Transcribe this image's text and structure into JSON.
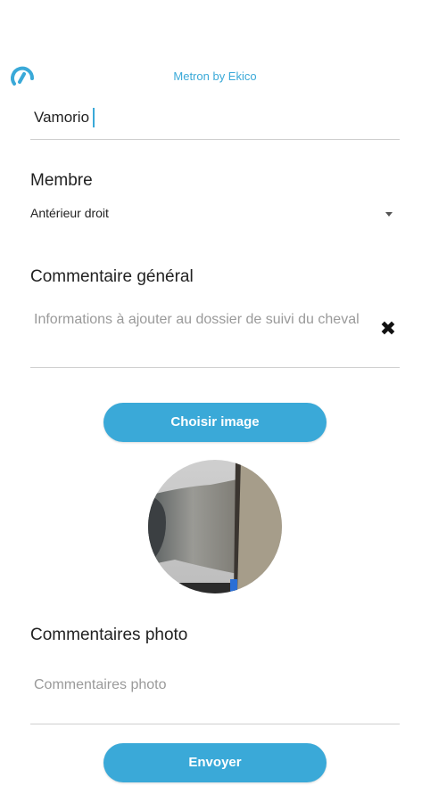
{
  "header": {
    "brand": "Metron by Ekico",
    "logo_icon": "metron-logo-icon"
  },
  "horse": {
    "name": "Vamorio"
  },
  "membre": {
    "label": "Membre",
    "selected": "Antérieur droit"
  },
  "general_comment": {
    "label": "Commentaire général",
    "placeholder": "Informations à ajouter au dossier de suivi du cheval",
    "clear_icon": "close-icon"
  },
  "choose_image_button": "Choisir image",
  "photo_comments": {
    "label": "Commentaires photo",
    "placeholder": "Commentaires photo"
  },
  "send_button": "Envoyer",
  "colors": {
    "accent": "#3aa9d8"
  }
}
